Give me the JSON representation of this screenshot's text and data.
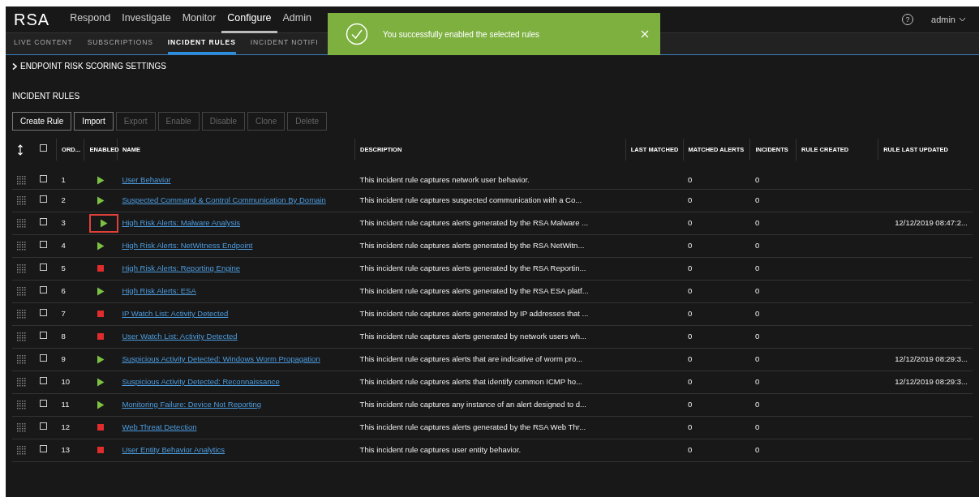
{
  "top_nav": {
    "logo": "RSA",
    "items": [
      {
        "label": "Respond",
        "selected": false
      },
      {
        "label": "Investigate",
        "selected": false
      },
      {
        "label": "Monitor",
        "selected": false
      },
      {
        "label": "Configure",
        "selected": true
      },
      {
        "label": "Admin",
        "selected": false
      }
    ],
    "help": "?",
    "user": "admin"
  },
  "sub_nav": [
    {
      "label": "LIVE CONTENT",
      "selected": false
    },
    {
      "label": "SUBSCRIPTIONS",
      "selected": false
    },
    {
      "label": "INCIDENT RULES",
      "selected": true
    },
    {
      "label": "INCIDENT NOTIFI",
      "selected": false
    }
  ],
  "toast": {
    "message": "You successfully enabled the selected rules"
  },
  "endpoint_section": {
    "label": "ENDPOINT RISK SCORING SETTINGS",
    "expanded": false
  },
  "section_title": "INCIDENT RULES",
  "toolbar": [
    {
      "label": "Create Rule",
      "disabled": false
    },
    {
      "label": "Import",
      "disabled": false
    },
    {
      "label": "Export",
      "disabled": true
    },
    {
      "label": "Enable",
      "disabled": true
    },
    {
      "label": "Disable",
      "disabled": true
    },
    {
      "label": "Clone",
      "disabled": true
    },
    {
      "label": "Delete",
      "disabled": true
    }
  ],
  "table": {
    "select_all_checked": false,
    "columns": [
      "ORD...",
      "ENABLED",
      "NAME",
      "DESCRIPTION",
      "LAST MATCHED",
      "MATCHED ALERTS",
      "INCIDENTS",
      "RULE CREATED",
      "RULE LAST UPDATED"
    ],
    "rows": [
      {
        "order": "1",
        "enabled": true,
        "checked": false,
        "highlighted": false,
        "name": "User Behavior",
        "description": "This incident rule captures network user behavior.",
        "matched_alerts": "0",
        "incidents": "0",
        "rule_last_updated": ""
      },
      {
        "order": "2",
        "enabled": true,
        "checked": false,
        "highlighted": false,
        "name": "Suspected Command & Control Communication By Domain",
        "description": "This incident rule captures suspected communication with a Co...",
        "matched_alerts": "0",
        "incidents": "0",
        "rule_last_updated": ""
      },
      {
        "order": "3",
        "enabled": true,
        "checked": false,
        "highlighted": true,
        "name": "High Risk Alerts: Malware Analysis",
        "description": "This incident rule captures alerts generated by the RSA Malware ...",
        "matched_alerts": "0",
        "incidents": "0",
        "rule_last_updated": "12/12/2019 08:47:2..."
      },
      {
        "order": "4",
        "enabled": true,
        "checked": false,
        "highlighted": false,
        "name": "High Risk Alerts: NetWitness Endpoint",
        "description": "This incident rule captures alerts generated by the RSA NetWitn...",
        "matched_alerts": "0",
        "incidents": "0",
        "rule_last_updated": ""
      },
      {
        "order": "5",
        "enabled": false,
        "checked": false,
        "highlighted": false,
        "name": "High Risk Alerts: Reporting Engine",
        "description": "This incident rule captures alerts generated by the RSA Reportin...",
        "matched_alerts": "0",
        "incidents": "0",
        "rule_last_updated": ""
      },
      {
        "order": "6",
        "enabled": true,
        "checked": false,
        "highlighted": false,
        "name": "High Risk Alerts: ESA",
        "description": "This incident rule captures alerts generated by the RSA ESA platf...",
        "matched_alerts": "0",
        "incidents": "0",
        "rule_last_updated": ""
      },
      {
        "order": "7",
        "enabled": false,
        "checked": false,
        "highlighted": false,
        "name": "IP Watch List: Activity Detected",
        "description": "This incident rule captures alerts generated by IP addresses that ...",
        "matched_alerts": "0",
        "incidents": "0",
        "rule_last_updated": ""
      },
      {
        "order": "8",
        "enabled": false,
        "checked": false,
        "highlighted": false,
        "name": "User Watch List: Activity Detected",
        "description": "This incident rule captures alerts generated by network users wh...",
        "matched_alerts": "0",
        "incidents": "0",
        "rule_last_updated": ""
      },
      {
        "order": "9",
        "enabled": true,
        "checked": false,
        "highlighted": false,
        "name": "Suspicious Activity Detected: Windows Worm Propagation",
        "description": "This incident rule captures alerts that are indicative of worm pro...",
        "matched_alerts": "0",
        "incidents": "0",
        "rule_last_updated": "12/12/2019 08:29:3..."
      },
      {
        "order": "10",
        "enabled": true,
        "checked": false,
        "highlighted": false,
        "name": "Suspicious Activity Detected: Reconnaissance",
        "description": "This incident rule captures alerts that identify common ICMP ho...",
        "matched_alerts": "0",
        "incidents": "0",
        "rule_last_updated": "12/12/2019 08:29:3..."
      },
      {
        "order": "11",
        "enabled": true,
        "checked": false,
        "highlighted": false,
        "name": "Monitoring Failure: Device Not Reporting",
        "description": "This incident rule captures any instance of an alert designed to d...",
        "matched_alerts": "0",
        "incidents": "0",
        "rule_last_updated": ""
      },
      {
        "order": "12",
        "enabled": false,
        "checked": false,
        "highlighted": false,
        "name": "Web Threat Detection",
        "description": "This incident rule captures alerts generated by the RSA Web Thr...",
        "matched_alerts": "0",
        "incidents": "0",
        "rule_last_updated": ""
      },
      {
        "order": "13",
        "enabled": false,
        "checked": false,
        "highlighted": false,
        "name": "User Entity Behavior Analytics",
        "description": "This incident rule captures user entity behavior.",
        "matched_alerts": "0",
        "incidents": "0",
        "rule_last_updated": ""
      }
    ]
  }
}
